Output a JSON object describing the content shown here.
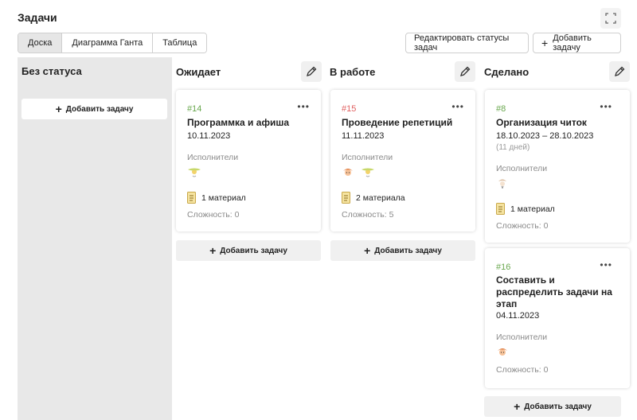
{
  "header": {
    "title": "Задачи",
    "fullscreen_icon": "fullscreen-icon"
  },
  "views": [
    "Доска",
    "Диаграмма Ганта",
    "Таблица"
  ],
  "active_view": "Доска",
  "actions": {
    "edit_statuses": "Редактировать статусы задач",
    "add_task": "Добавить задачу"
  },
  "colors": {
    "id_green": "#6aa84f",
    "id_red": "#e06060",
    "column_nostatus_bg": "#e8e8e8"
  },
  "columns": [
    {
      "title": "Без статуса",
      "add_label": "Добавить задачу",
      "cards": []
    },
    {
      "title": "Ожидает",
      "add_label": "Добавить задачу",
      "cards": [
        {
          "id": "#14",
          "title": "Программка и афиша",
          "date": "10.11.2023",
          "assignees_label": "Исполнители",
          "materials": "1 материал",
          "difficulty": "Сложность: 0"
        }
      ]
    },
    {
      "title": "В работе",
      "add_label": "Добавить задачу",
      "cards": [
        {
          "id": "#15",
          "title": "Проведение репетиций",
          "date": "11.11.2023",
          "assignees_label": "Исполнители",
          "materials": "2 материала",
          "difficulty": "Сложность: 5"
        }
      ]
    },
    {
      "title": "Сделано",
      "add_label": "Добавить задачу",
      "cards": [
        {
          "id": "#8",
          "title": "Организация читок",
          "date": "18.10.2023 – 28.10.2023",
          "duration": "(11 дней)",
          "assignees_label": "Исполнители",
          "materials": "1 материал",
          "difficulty": "Сложность: 0"
        },
        {
          "id": "#16",
          "title_lines": [
            "Составить и",
            "распределить задачи на",
            "этап"
          ],
          "date": "04.11.2023",
          "assignees_label": "Исполнители",
          "difficulty": "Сложность: 0"
        }
      ]
    }
  ]
}
